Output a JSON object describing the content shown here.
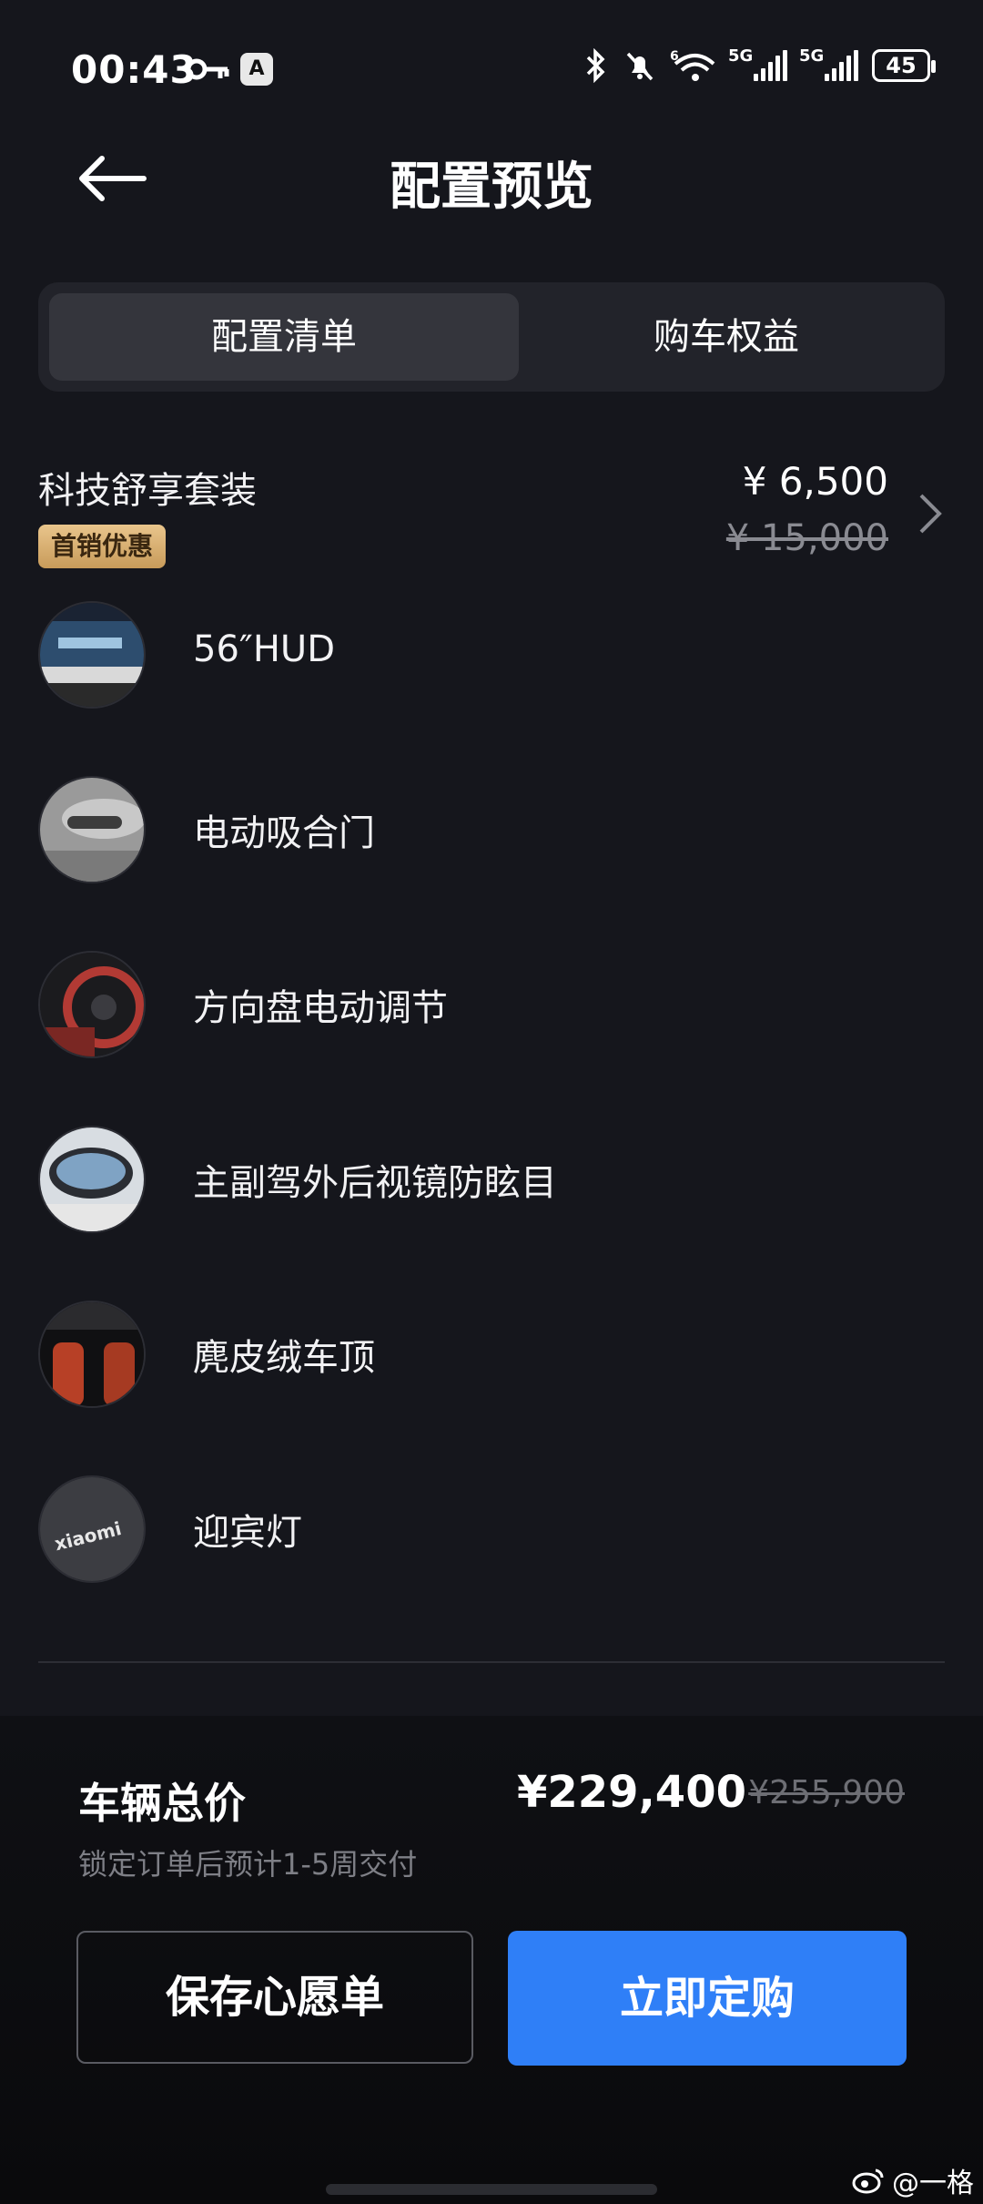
{
  "status": {
    "time": "00:43",
    "battery": "45",
    "net1": "5G",
    "net2": "5G",
    "wifi_badge": "6"
  },
  "header": {
    "title": "配置预览"
  },
  "tabs": [
    {
      "label": "配置清单"
    },
    {
      "label": "购车权益"
    }
  ],
  "package": {
    "name": "科技舒享套装",
    "badge": "首销优惠",
    "price": "¥ 6,500",
    "original_price": "¥ 15,000"
  },
  "features": [
    {
      "label": "56″HUD",
      "thumb_label": ""
    },
    {
      "label": "电动吸合门",
      "thumb_label": ""
    },
    {
      "label": "方向盘电动调节",
      "thumb_label": ""
    },
    {
      "label": "主副驾外后视镜防眩目",
      "thumb_label": ""
    },
    {
      "label": "麂皮绒车顶",
      "thumb_label": ""
    },
    {
      "label": "迎宾灯",
      "thumb_label": "xiaomi"
    }
  ],
  "summary": {
    "total_label": "车辆总价",
    "total_price": "¥229,400",
    "original_total": "¥255,900",
    "delivery_note": "锁定订单后预计1-5周交付"
  },
  "actions": {
    "save_label": "保存心愿单",
    "buy_label": "立即定购"
  },
  "watermark": "@一格",
  "colors": {
    "accent": "#2f7ff7",
    "badge": "#d9b072",
    "background": "#15161c"
  }
}
